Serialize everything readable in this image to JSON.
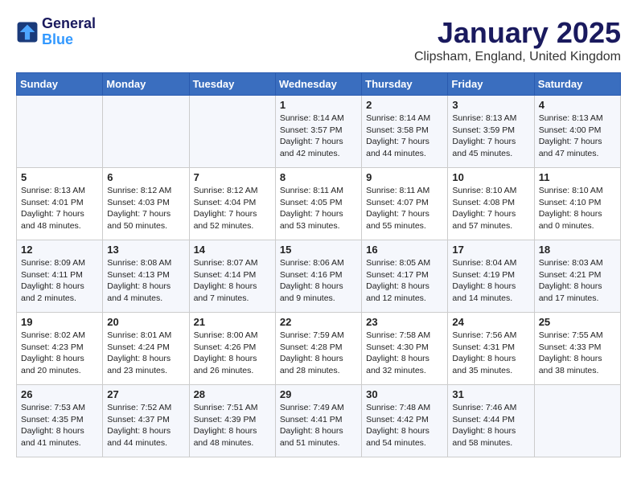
{
  "header": {
    "logo_line1": "General",
    "logo_line2": "Blue",
    "month": "January 2025",
    "location": "Clipsham, England, United Kingdom"
  },
  "weekdays": [
    "Sunday",
    "Monday",
    "Tuesday",
    "Wednesday",
    "Thursday",
    "Friday",
    "Saturday"
  ],
  "weeks": [
    [
      {
        "day": "",
        "info": ""
      },
      {
        "day": "",
        "info": ""
      },
      {
        "day": "",
        "info": ""
      },
      {
        "day": "1",
        "info": "Sunrise: 8:14 AM\nSunset: 3:57 PM\nDaylight: 7 hours and 42 minutes."
      },
      {
        "day": "2",
        "info": "Sunrise: 8:14 AM\nSunset: 3:58 PM\nDaylight: 7 hours and 44 minutes."
      },
      {
        "day": "3",
        "info": "Sunrise: 8:13 AM\nSunset: 3:59 PM\nDaylight: 7 hours and 45 minutes."
      },
      {
        "day": "4",
        "info": "Sunrise: 8:13 AM\nSunset: 4:00 PM\nDaylight: 7 hours and 47 minutes."
      }
    ],
    [
      {
        "day": "5",
        "info": "Sunrise: 8:13 AM\nSunset: 4:01 PM\nDaylight: 7 hours and 48 minutes."
      },
      {
        "day": "6",
        "info": "Sunrise: 8:12 AM\nSunset: 4:03 PM\nDaylight: 7 hours and 50 minutes."
      },
      {
        "day": "7",
        "info": "Sunrise: 8:12 AM\nSunset: 4:04 PM\nDaylight: 7 hours and 52 minutes."
      },
      {
        "day": "8",
        "info": "Sunrise: 8:11 AM\nSunset: 4:05 PM\nDaylight: 7 hours and 53 minutes."
      },
      {
        "day": "9",
        "info": "Sunrise: 8:11 AM\nSunset: 4:07 PM\nDaylight: 7 hours and 55 minutes."
      },
      {
        "day": "10",
        "info": "Sunrise: 8:10 AM\nSunset: 4:08 PM\nDaylight: 7 hours and 57 minutes."
      },
      {
        "day": "11",
        "info": "Sunrise: 8:10 AM\nSunset: 4:10 PM\nDaylight: 8 hours and 0 minutes."
      }
    ],
    [
      {
        "day": "12",
        "info": "Sunrise: 8:09 AM\nSunset: 4:11 PM\nDaylight: 8 hours and 2 minutes."
      },
      {
        "day": "13",
        "info": "Sunrise: 8:08 AM\nSunset: 4:13 PM\nDaylight: 8 hours and 4 minutes."
      },
      {
        "day": "14",
        "info": "Sunrise: 8:07 AM\nSunset: 4:14 PM\nDaylight: 8 hours and 7 minutes."
      },
      {
        "day": "15",
        "info": "Sunrise: 8:06 AM\nSunset: 4:16 PM\nDaylight: 8 hours and 9 minutes."
      },
      {
        "day": "16",
        "info": "Sunrise: 8:05 AM\nSunset: 4:17 PM\nDaylight: 8 hours and 12 minutes."
      },
      {
        "day": "17",
        "info": "Sunrise: 8:04 AM\nSunset: 4:19 PM\nDaylight: 8 hours and 14 minutes."
      },
      {
        "day": "18",
        "info": "Sunrise: 8:03 AM\nSunset: 4:21 PM\nDaylight: 8 hours and 17 minutes."
      }
    ],
    [
      {
        "day": "19",
        "info": "Sunrise: 8:02 AM\nSunset: 4:23 PM\nDaylight: 8 hours and 20 minutes."
      },
      {
        "day": "20",
        "info": "Sunrise: 8:01 AM\nSunset: 4:24 PM\nDaylight: 8 hours and 23 minutes."
      },
      {
        "day": "21",
        "info": "Sunrise: 8:00 AM\nSunset: 4:26 PM\nDaylight: 8 hours and 26 minutes."
      },
      {
        "day": "22",
        "info": "Sunrise: 7:59 AM\nSunset: 4:28 PM\nDaylight: 8 hours and 28 minutes."
      },
      {
        "day": "23",
        "info": "Sunrise: 7:58 AM\nSunset: 4:30 PM\nDaylight: 8 hours and 32 minutes."
      },
      {
        "day": "24",
        "info": "Sunrise: 7:56 AM\nSunset: 4:31 PM\nDaylight: 8 hours and 35 minutes."
      },
      {
        "day": "25",
        "info": "Sunrise: 7:55 AM\nSunset: 4:33 PM\nDaylight: 8 hours and 38 minutes."
      }
    ],
    [
      {
        "day": "26",
        "info": "Sunrise: 7:53 AM\nSunset: 4:35 PM\nDaylight: 8 hours and 41 minutes."
      },
      {
        "day": "27",
        "info": "Sunrise: 7:52 AM\nSunset: 4:37 PM\nDaylight: 8 hours and 44 minutes."
      },
      {
        "day": "28",
        "info": "Sunrise: 7:51 AM\nSunset: 4:39 PM\nDaylight: 8 hours and 48 minutes."
      },
      {
        "day": "29",
        "info": "Sunrise: 7:49 AM\nSunset: 4:41 PM\nDaylight: 8 hours and 51 minutes."
      },
      {
        "day": "30",
        "info": "Sunrise: 7:48 AM\nSunset: 4:42 PM\nDaylight: 8 hours and 54 minutes."
      },
      {
        "day": "31",
        "info": "Sunrise: 7:46 AM\nSunset: 4:44 PM\nDaylight: 8 hours and 58 minutes."
      },
      {
        "day": "",
        "info": ""
      }
    ]
  ]
}
